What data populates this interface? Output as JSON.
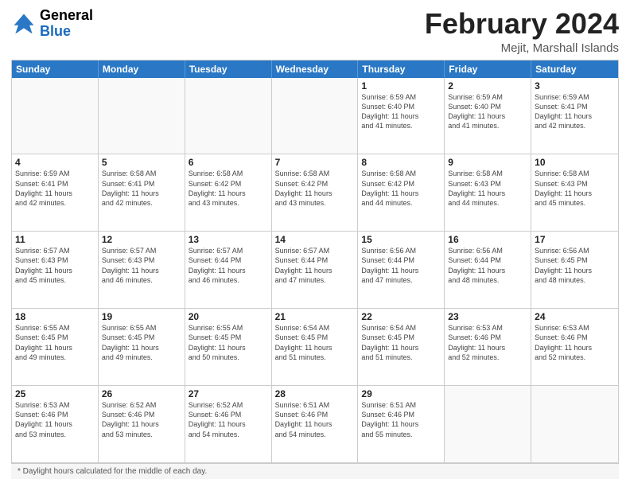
{
  "header": {
    "logo_line1": "General",
    "logo_line2": "Blue",
    "month_title": "February 2024",
    "location": "Mejit, Marshall Islands"
  },
  "weekdays": [
    "Sunday",
    "Monday",
    "Tuesday",
    "Wednesday",
    "Thursday",
    "Friday",
    "Saturday"
  ],
  "note": "Daylight hours",
  "weeks": [
    [
      {
        "day": "",
        "detail": ""
      },
      {
        "day": "",
        "detail": ""
      },
      {
        "day": "",
        "detail": ""
      },
      {
        "day": "",
        "detail": ""
      },
      {
        "day": "1",
        "detail": "Sunrise: 6:59 AM\nSunset: 6:40 PM\nDaylight: 11 hours\nand 41 minutes."
      },
      {
        "day": "2",
        "detail": "Sunrise: 6:59 AM\nSunset: 6:40 PM\nDaylight: 11 hours\nand 41 minutes."
      },
      {
        "day": "3",
        "detail": "Sunrise: 6:59 AM\nSunset: 6:41 PM\nDaylight: 11 hours\nand 42 minutes."
      }
    ],
    [
      {
        "day": "4",
        "detail": "Sunrise: 6:59 AM\nSunset: 6:41 PM\nDaylight: 11 hours\nand 42 minutes."
      },
      {
        "day": "5",
        "detail": "Sunrise: 6:58 AM\nSunset: 6:41 PM\nDaylight: 11 hours\nand 42 minutes."
      },
      {
        "day": "6",
        "detail": "Sunrise: 6:58 AM\nSunset: 6:42 PM\nDaylight: 11 hours\nand 43 minutes."
      },
      {
        "day": "7",
        "detail": "Sunrise: 6:58 AM\nSunset: 6:42 PM\nDaylight: 11 hours\nand 43 minutes."
      },
      {
        "day": "8",
        "detail": "Sunrise: 6:58 AM\nSunset: 6:42 PM\nDaylight: 11 hours\nand 44 minutes."
      },
      {
        "day": "9",
        "detail": "Sunrise: 6:58 AM\nSunset: 6:43 PM\nDaylight: 11 hours\nand 44 minutes."
      },
      {
        "day": "10",
        "detail": "Sunrise: 6:58 AM\nSunset: 6:43 PM\nDaylight: 11 hours\nand 45 minutes."
      }
    ],
    [
      {
        "day": "11",
        "detail": "Sunrise: 6:57 AM\nSunset: 6:43 PM\nDaylight: 11 hours\nand 45 minutes."
      },
      {
        "day": "12",
        "detail": "Sunrise: 6:57 AM\nSunset: 6:43 PM\nDaylight: 11 hours\nand 46 minutes."
      },
      {
        "day": "13",
        "detail": "Sunrise: 6:57 AM\nSunset: 6:44 PM\nDaylight: 11 hours\nand 46 minutes."
      },
      {
        "day": "14",
        "detail": "Sunrise: 6:57 AM\nSunset: 6:44 PM\nDaylight: 11 hours\nand 47 minutes."
      },
      {
        "day": "15",
        "detail": "Sunrise: 6:56 AM\nSunset: 6:44 PM\nDaylight: 11 hours\nand 47 minutes."
      },
      {
        "day": "16",
        "detail": "Sunrise: 6:56 AM\nSunset: 6:44 PM\nDaylight: 11 hours\nand 48 minutes."
      },
      {
        "day": "17",
        "detail": "Sunrise: 6:56 AM\nSunset: 6:45 PM\nDaylight: 11 hours\nand 48 minutes."
      }
    ],
    [
      {
        "day": "18",
        "detail": "Sunrise: 6:55 AM\nSunset: 6:45 PM\nDaylight: 11 hours\nand 49 minutes."
      },
      {
        "day": "19",
        "detail": "Sunrise: 6:55 AM\nSunset: 6:45 PM\nDaylight: 11 hours\nand 49 minutes."
      },
      {
        "day": "20",
        "detail": "Sunrise: 6:55 AM\nSunset: 6:45 PM\nDaylight: 11 hours\nand 50 minutes."
      },
      {
        "day": "21",
        "detail": "Sunrise: 6:54 AM\nSunset: 6:45 PM\nDaylight: 11 hours\nand 51 minutes."
      },
      {
        "day": "22",
        "detail": "Sunrise: 6:54 AM\nSunset: 6:45 PM\nDaylight: 11 hours\nand 51 minutes."
      },
      {
        "day": "23",
        "detail": "Sunrise: 6:53 AM\nSunset: 6:46 PM\nDaylight: 11 hours\nand 52 minutes."
      },
      {
        "day": "24",
        "detail": "Sunrise: 6:53 AM\nSunset: 6:46 PM\nDaylight: 11 hours\nand 52 minutes."
      }
    ],
    [
      {
        "day": "25",
        "detail": "Sunrise: 6:53 AM\nSunset: 6:46 PM\nDaylight: 11 hours\nand 53 minutes."
      },
      {
        "day": "26",
        "detail": "Sunrise: 6:52 AM\nSunset: 6:46 PM\nDaylight: 11 hours\nand 53 minutes."
      },
      {
        "day": "27",
        "detail": "Sunrise: 6:52 AM\nSunset: 6:46 PM\nDaylight: 11 hours\nand 54 minutes."
      },
      {
        "day": "28",
        "detail": "Sunrise: 6:51 AM\nSunset: 6:46 PM\nDaylight: 11 hours\nand 54 minutes."
      },
      {
        "day": "29",
        "detail": "Sunrise: 6:51 AM\nSunset: 6:46 PM\nDaylight: 11 hours\nand 55 minutes."
      },
      {
        "day": "",
        "detail": ""
      },
      {
        "day": "",
        "detail": ""
      }
    ]
  ]
}
